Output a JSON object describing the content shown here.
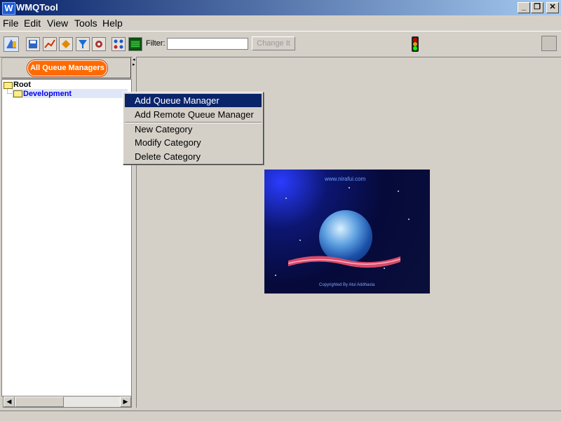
{
  "window": {
    "title": "WMQTool",
    "icon_letter": "W"
  },
  "window_controls": {
    "minimize": "_",
    "restore": "❐",
    "close": "✕"
  },
  "menubar": {
    "items": [
      "File",
      "Edit",
      "View",
      "Tools",
      "Help"
    ]
  },
  "toolbar": {
    "filter_label": "Filter:",
    "filter_value": "",
    "change_button": "Change It",
    "icons": [
      "connect-icon",
      "save-icon",
      "chart-icon",
      "tag-icon",
      "filter-icon",
      "settings-icon",
      "grid-icon",
      "monitor-icon"
    ],
    "status_light": "traffic-light-icon"
  },
  "left_panel": {
    "all_queue_managers_button": "All Queue Managers",
    "tree": {
      "root": "Root",
      "children": [
        "Development"
      ]
    }
  },
  "context_menu": {
    "items": [
      {
        "label": "Add Queue Manager",
        "selected": true
      },
      {
        "label": "Add Remote Queue Manager",
        "selected": false
      },
      {
        "label": "New Category",
        "selected": false
      },
      {
        "label": "Modify Category",
        "selected": false
      },
      {
        "label": "Delete Category",
        "selected": false
      }
    ]
  },
  "splash": {
    "url": "www.nirafui.com",
    "copyright": "Copyrighted By Atul Addhasta"
  }
}
